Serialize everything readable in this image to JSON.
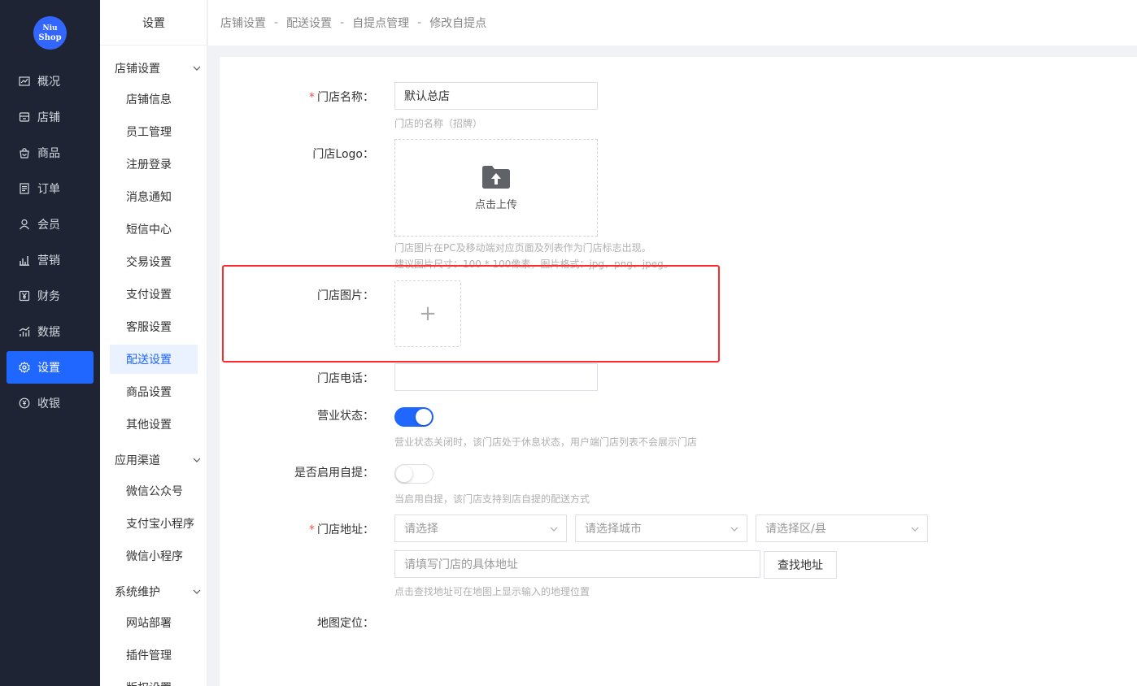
{
  "brand": {
    "line1": "Niu",
    "line2": "Shop"
  },
  "nav": [
    {
      "label": "概况",
      "icon": "chart-icon"
    },
    {
      "label": "店铺",
      "icon": "store-icon"
    },
    {
      "label": "商品",
      "icon": "goods-bag-icon"
    },
    {
      "label": "订单",
      "icon": "order-list-icon"
    },
    {
      "label": "会员",
      "icon": "user-icon"
    },
    {
      "label": "营销",
      "icon": "bar-chart-icon"
    },
    {
      "label": "财务",
      "icon": "yen-icon"
    },
    {
      "label": "数据",
      "icon": "data-chart-icon"
    },
    {
      "label": "设置",
      "icon": "gear-icon",
      "active": true
    },
    {
      "label": "收银",
      "icon": "cashier-icon"
    }
  ],
  "submenu": {
    "title": "设置",
    "groups": [
      {
        "label": "店铺设置",
        "items": [
          "店铺信息",
          "员工管理",
          "注册登录",
          "消息通知",
          "短信中心",
          "交易设置",
          "支付设置",
          "客服设置",
          "配送设置",
          "商品设置",
          "其他设置"
        ]
      },
      {
        "label": "应用渠道",
        "items": [
          "微信公众号",
          "支付宝小程序",
          "微信小程序"
        ]
      },
      {
        "label": "系统维护",
        "items": [
          "网站部署",
          "插件管理",
          "版权设置"
        ]
      }
    ],
    "active_item": "配送设置"
  },
  "breadcrumb": [
    "店铺设置",
    "配送设置",
    "自提点管理",
    "修改自提点"
  ],
  "breadcrumb_sep": "-",
  "form": {
    "name_label": "门店名称：",
    "name_value": "默认总店",
    "name_hint": "门店的名称（招牌）",
    "logo_label": "门店Logo：",
    "logo_upload_text": "点击上传",
    "logo_hint_1": "门店图片在PC及移动端对应页面及列表作为门店标志出现。",
    "logo_hint_2": "建议图片尺寸：100 * 100像素，图片格式：jpg、png、jpeg。",
    "picture_label": "门店图片：",
    "picture_add": "+",
    "phone_label": "门店电话：",
    "phone_value": "",
    "status_label": "营业状态：",
    "status_on": true,
    "status_hint": "营业状态关闭时，该门店处于休息状态，用户端门店列表不会展示门店",
    "pickup_label": "是否启用自提：",
    "pickup_on": false,
    "pickup_hint": "当启用自提，该门店支持到店自提的配送方式",
    "address_label": "门店地址：",
    "province_placeholder": "请选择",
    "city_placeholder": "请选择城市",
    "district_placeholder": "请选择区/县",
    "detail_placeholder": "请填写门店的具体地址",
    "find_button": "查找地址",
    "address_hint": "点击查找地址可在地图上显示输入的地理位置",
    "map_label": "地图定位：",
    "required_mark": "*"
  },
  "colors": {
    "accent": "#1f67ff",
    "nav_bg": "#1e2433",
    "highlight": "#ff2a2a",
    "required": "#ff4d4f"
  }
}
